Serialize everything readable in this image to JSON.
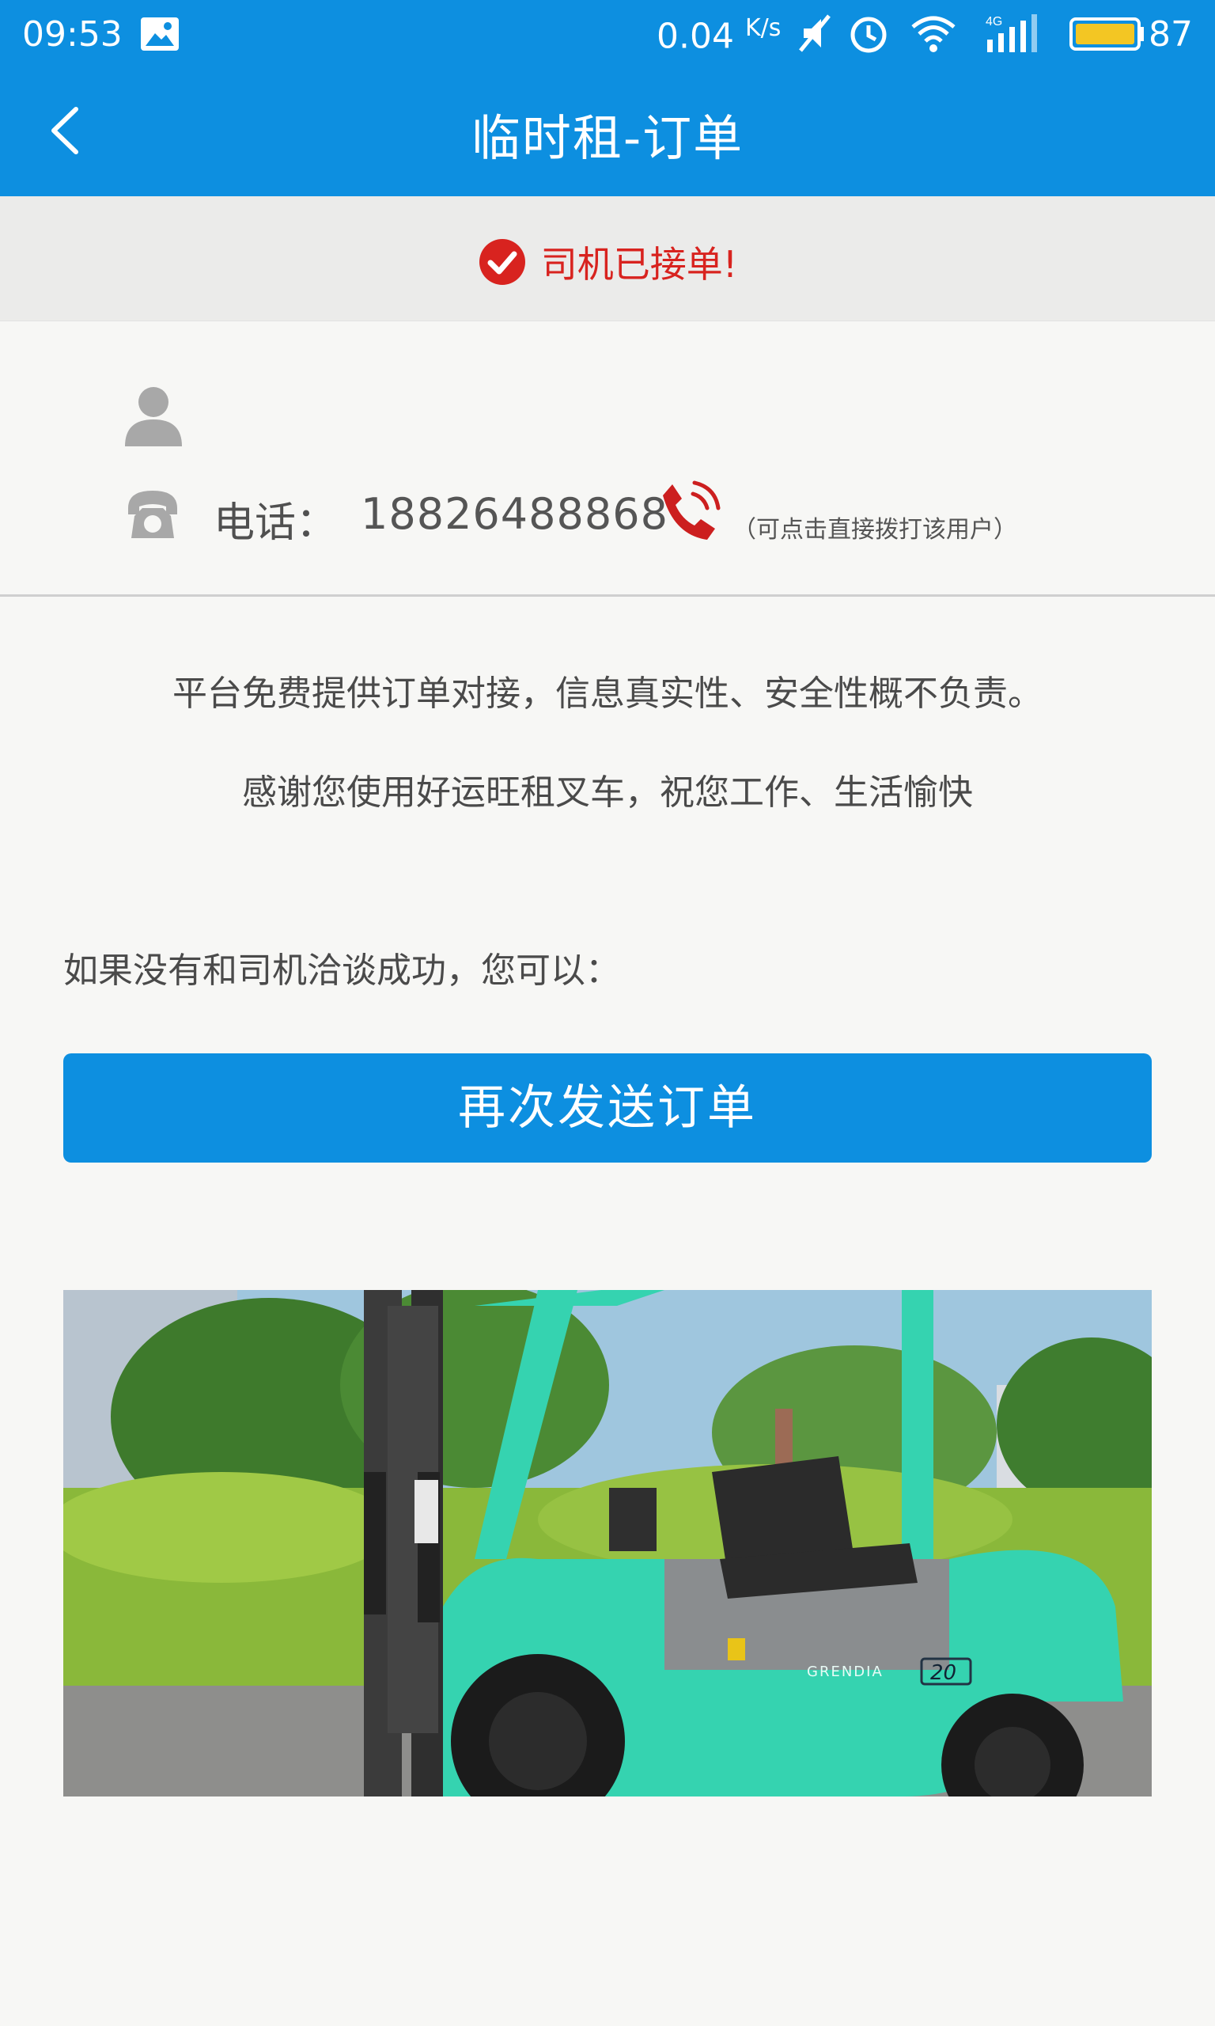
{
  "status_bar": {
    "time": "09:53",
    "net_speed": "0.04",
    "net_speed_unit": "K/s",
    "battery": "87",
    "icons": [
      "image-icon",
      "mute-icon",
      "alarm-icon",
      "wifi-icon",
      "signal-4g-icon",
      "battery-icon"
    ]
  },
  "header": {
    "title": "临时租-订单",
    "back_icon": "chevron-left-icon"
  },
  "banner": {
    "icon": "check-circle-icon",
    "text": "司机已接单!"
  },
  "driver": {
    "avatar_icon": "user-icon",
    "phone_icon": "telephone-icon",
    "phone_label": "电话：",
    "phone_number": "18826488868",
    "call_icon": "phone-call-icon",
    "call_hint": "（可点击直接拨打该用户）"
  },
  "notice": {
    "disclaimer": "平台免费提供订单对接，信息真实性、安全性概不负责。",
    "thanks": "感谢您使用好运旺租叉车，祝您工作、生活愉快"
  },
  "fallback": {
    "text": "如果没有和司机洽谈成功，您可以：",
    "resend_label": "再次发送订单"
  },
  "photo": {
    "badge_text": "GRENDIA",
    "model_text": "20"
  },
  "colors": {
    "primary": "#0d8fe0",
    "success_red": "#d8231f",
    "background": "#f7f7f5",
    "forklift_green": "#35d3b0"
  }
}
